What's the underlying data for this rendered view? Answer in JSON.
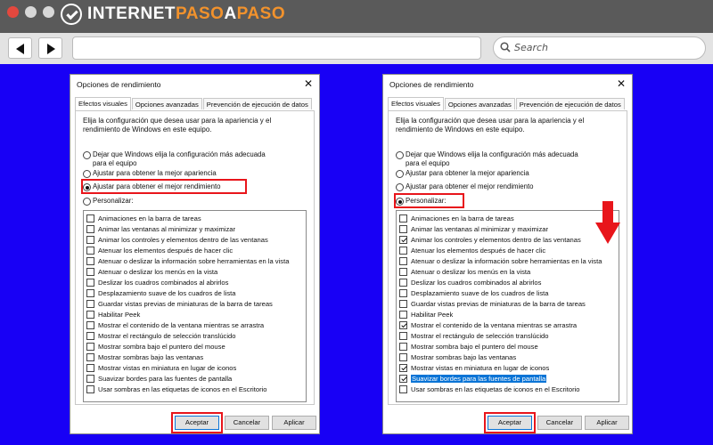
{
  "browser": {
    "logo_part1": "INTERNET",
    "logo_part2": "PASO",
    "logo_part3": "A",
    "logo_part4": "PASO",
    "search_placeholder": "Search"
  },
  "colors": {
    "background": "#1800f5",
    "highlight": "#e8151b",
    "logo_accent": "#f2922c",
    "selection": "#0a74d6"
  },
  "dialog1": {
    "title": "Opciones de rendimiento",
    "tabs": [
      "Efectos visuales",
      "Opciones avanzadas",
      "Prevención de ejecución de datos"
    ],
    "intro": "Elija la configuración que desea usar para la apariencia y el rendimiento de Windows en este equipo.",
    "radios": [
      {
        "label": "Dejar que Windows elija la configuración más adecuada para el equipo",
        "selected": false
      },
      {
        "label": "Ajustar para obtener la mejor apariencia",
        "selected": false
      },
      {
        "label": "Ajustar para obtener el mejor rendimiento",
        "selected": true
      },
      {
        "label": "Personalizar:",
        "selected": false
      }
    ],
    "checkboxes": [
      {
        "label": "Animaciones en la barra de tareas",
        "checked": false
      },
      {
        "label": "Animar las ventanas al minimizar y maximizar",
        "checked": false
      },
      {
        "label": "Animar los controles y elementos dentro de las ventanas",
        "checked": false
      },
      {
        "label": "Atenuar los elementos después de hacer clic",
        "checked": false
      },
      {
        "label": "Atenuar o deslizar la información sobre herramientas en la vista",
        "checked": false
      },
      {
        "label": "Atenuar o deslizar los menús en la vista",
        "checked": false
      },
      {
        "label": "Deslizar los cuadros combinados al abrirlos",
        "checked": false
      },
      {
        "label": "Desplazamiento suave de los cuadros de lista",
        "checked": false
      },
      {
        "label": "Guardar vistas previas de miniaturas de la barra de tareas",
        "checked": false
      },
      {
        "label": "Habilitar Peek",
        "checked": false
      },
      {
        "label": "Mostrar el contenido de la ventana mientras se arrastra",
        "checked": false
      },
      {
        "label": "Mostrar el rectángulo de selección translúcido",
        "checked": false
      },
      {
        "label": "Mostrar sombra bajo el puntero del mouse",
        "checked": false
      },
      {
        "label": "Mostrar sombras bajo las ventanas",
        "checked": false
      },
      {
        "label": "Mostrar vistas en miniatura en lugar de iconos",
        "checked": false
      },
      {
        "label": "Suavizar bordes para las fuentes de pantalla",
        "checked": false
      },
      {
        "label": "Usar sombras en las etiquetas de iconos en el Escritorio",
        "checked": false
      }
    ],
    "buttons": {
      "ok": "Aceptar",
      "cancel": "Cancelar",
      "apply": "Aplicar"
    }
  },
  "dialog2": {
    "title": "Opciones de rendimiento",
    "tabs": [
      "Efectos visuales",
      "Opciones avanzadas",
      "Prevención de ejecución de datos"
    ],
    "intro": "Elija la configuración que desea usar para la apariencia y el rendimiento de Windows en este equipo.",
    "radios": [
      {
        "label": "Dejar que Windows elija la configuración más adecuada para el equipo",
        "selected": false
      },
      {
        "label": "Ajustar para obtener la mejor apariencia",
        "selected": false
      },
      {
        "label": "Ajustar para obtener el mejor rendimiento",
        "selected": false
      },
      {
        "label": "Personalizar:",
        "selected": true
      }
    ],
    "checkboxes": [
      {
        "label": "Animaciones en la barra de tareas",
        "checked": false
      },
      {
        "label": "Animar las ventanas al minimizar y maximizar",
        "checked": false
      },
      {
        "label": "Animar los controles y elementos dentro de las ventanas",
        "checked": true
      },
      {
        "label": "Atenuar los elementos después de hacer clic",
        "checked": false
      },
      {
        "label": "Atenuar o deslizar la información sobre herramientas en la vista",
        "checked": false
      },
      {
        "label": "Atenuar o deslizar los menús en la vista",
        "checked": false
      },
      {
        "label": "Deslizar los cuadros combinados al abrirlos",
        "checked": false
      },
      {
        "label": "Desplazamiento suave de los cuadros de lista",
        "checked": false
      },
      {
        "label": "Guardar vistas previas de miniaturas de la barra de tareas",
        "checked": false
      },
      {
        "label": "Habilitar Peek",
        "checked": false
      },
      {
        "label": "Mostrar el contenido de la ventana mientras se arrastra",
        "checked": true
      },
      {
        "label": "Mostrar el rectángulo de selección translúcido",
        "checked": false
      },
      {
        "label": "Mostrar sombra bajo el puntero del mouse",
        "checked": false
      },
      {
        "label": "Mostrar sombras bajo las ventanas",
        "checked": false
      },
      {
        "label": "Mostrar vistas en miniatura en lugar de iconos",
        "checked": true
      },
      {
        "label": "Suavizar bordes para las fuentes de pantalla",
        "checked": true,
        "focused": true
      },
      {
        "label": "Usar sombras en las etiquetas de iconos en el Escritorio",
        "checked": false
      }
    ],
    "buttons": {
      "ok": "Aceptar",
      "cancel": "Cancelar",
      "apply": "Aplicar"
    }
  }
}
